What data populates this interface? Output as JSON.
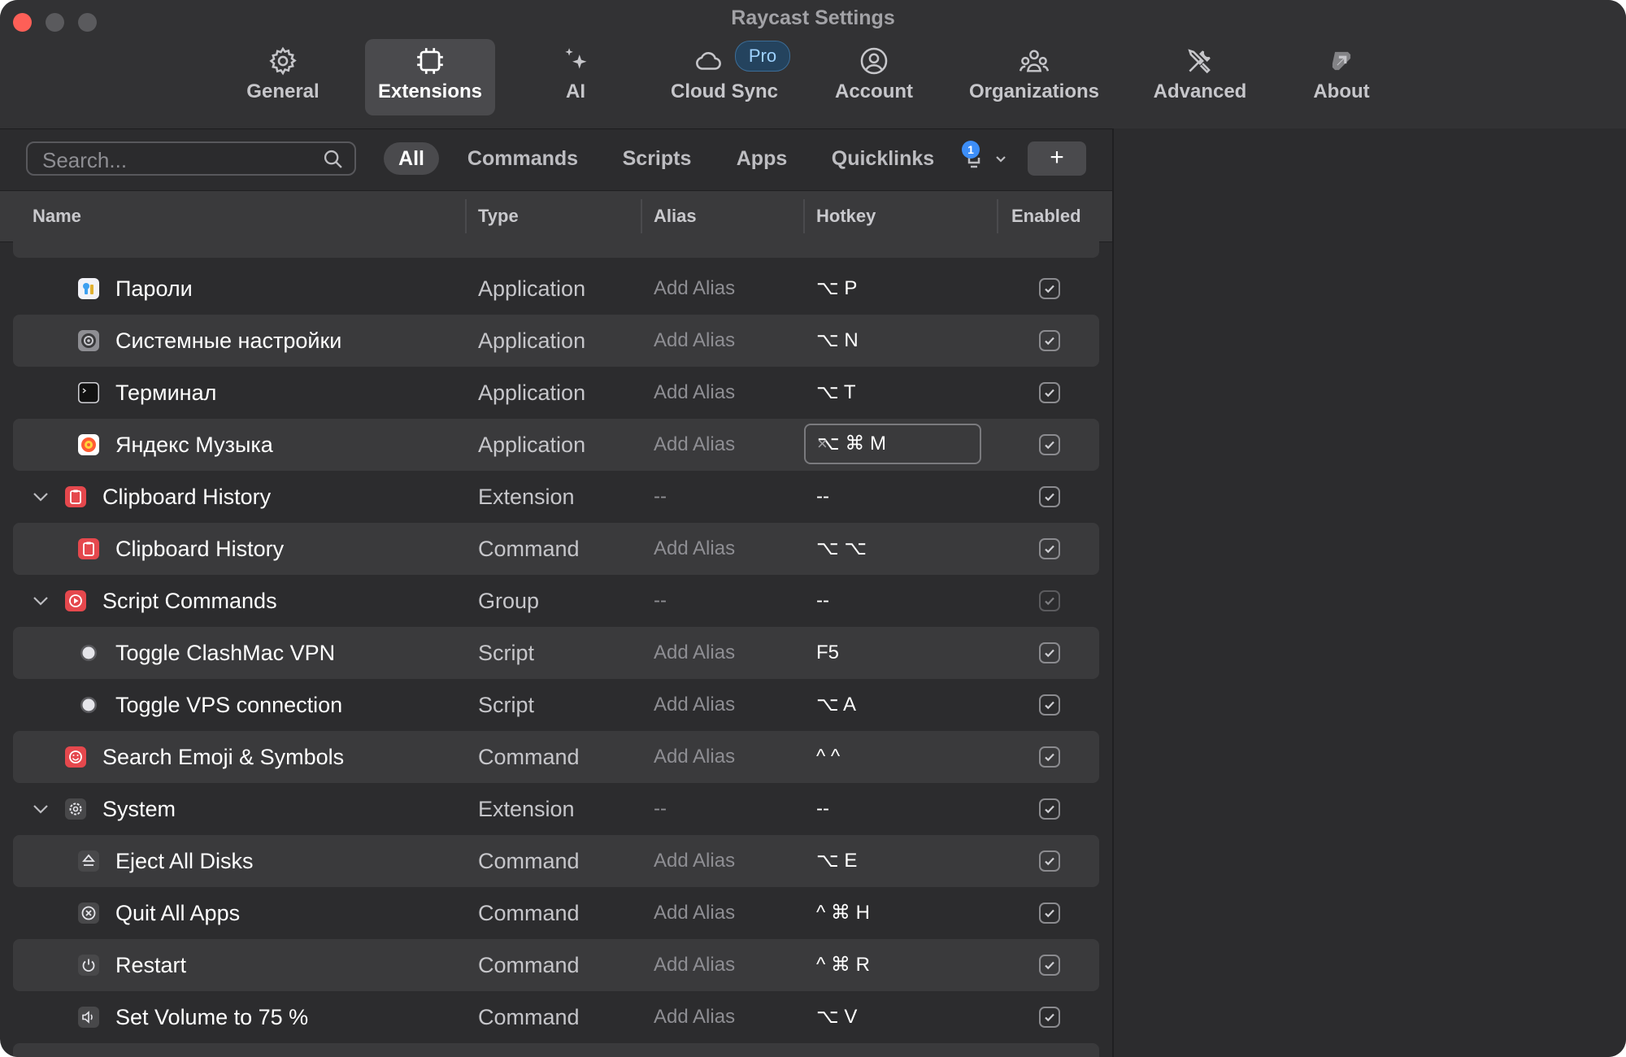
{
  "window": {
    "title": "Raycast Settings"
  },
  "tabs": [
    {
      "label": "General",
      "icon": "gear-icon"
    },
    {
      "label": "Extensions",
      "icon": "chip-icon"
    },
    {
      "label": "AI",
      "icon": "sparkles-icon"
    },
    {
      "label": "Cloud Sync",
      "icon": "cloud-icon",
      "badge": "Pro"
    },
    {
      "label": "Account",
      "icon": "person-circle-icon"
    },
    {
      "label": "Organizations",
      "icon": "people-icon"
    },
    {
      "label": "Advanced",
      "icon": "tools-icon"
    },
    {
      "label": "About",
      "icon": "raycast-logo-icon"
    }
  ],
  "active_tab": "Extensions",
  "search": {
    "placeholder": "Search...",
    "value": ""
  },
  "filters": [
    "All",
    "Commands",
    "Scripts",
    "Apps",
    "Quicklinks"
  ],
  "active_filter": "All",
  "notifications": {
    "count": "1"
  },
  "add_button": {
    "label": "+"
  },
  "columns": {
    "name": "Name",
    "type": "Type",
    "alias": "Alias",
    "hotkey": "Hotkey",
    "enabled": "Enabled"
  },
  "rows": [
    {
      "name": "Пароли",
      "type": "Application",
      "alias": "Add Alias",
      "hotkey": "⌥ P",
      "enabled": true,
      "icon": "passwords-app-icon"
    },
    {
      "name": "Системные настройки",
      "type": "Application",
      "alias": "Add Alias",
      "hotkey": "⌥ N",
      "enabled": true,
      "icon": "system-settings-app-icon"
    },
    {
      "name": "Терминал",
      "type": "Application",
      "alias": "Add Alias",
      "hotkey": "⌥ T",
      "enabled": true,
      "icon": "terminal-app-icon"
    },
    {
      "name": "Яндекс Музыка",
      "type": "Application",
      "alias": "Add Alias",
      "hotkey": "⌥ ⌘ M",
      "enabled": true,
      "icon": "yandex-music-app-icon",
      "editing_hotkey": true,
      "clear_label": "×"
    },
    {
      "name": "Clipboard History",
      "type": "Extension",
      "alias": "--",
      "hotkey": "--",
      "enabled": true,
      "icon": "clipboard-icon",
      "group": true
    },
    {
      "name": "Clipboard History",
      "type": "Command",
      "alias": "Add Alias",
      "hotkey": "⌥ ⌥",
      "enabled": true,
      "icon": "clipboard-icon"
    },
    {
      "name": "Script Commands",
      "type": "Group",
      "alias": "--",
      "hotkey": "--",
      "enabled": true,
      "icon": "script-commands-icon",
      "group": true,
      "dim": true
    },
    {
      "name": "Toggle ClashMac VPN",
      "type": "Script",
      "alias": "Add Alias",
      "hotkey": "F5",
      "enabled": true,
      "icon": "script-dot-icon"
    },
    {
      "name": "Toggle VPS connection",
      "type": "Script",
      "alias": "Add Alias",
      "hotkey": "⌥ A",
      "enabled": true,
      "icon": "script-dot-icon"
    },
    {
      "name": "Search Emoji & Symbols",
      "type": "Command",
      "alias": "Add Alias",
      "hotkey": "^ ^",
      "enabled": true,
      "icon": "emoji-icon",
      "top": true
    },
    {
      "name": "System",
      "type": "Extension",
      "alias": "--",
      "hotkey": "--",
      "enabled": true,
      "icon": "system-gear-icon",
      "group": true
    },
    {
      "name": "Eject All Disks",
      "type": "Command",
      "alias": "Add Alias",
      "hotkey": "⌥ E",
      "enabled": true,
      "icon": "eject-icon"
    },
    {
      "name": "Quit All Apps",
      "type": "Command",
      "alias": "Add Alias",
      "hotkey": "^ ⌘ H",
      "enabled": true,
      "icon": "quit-icon"
    },
    {
      "name": "Restart",
      "type": "Command",
      "alias": "Add Alias",
      "hotkey": "^ ⌘ R",
      "enabled": true,
      "icon": "power-icon"
    },
    {
      "name": "Set Volume to 75 %",
      "type": "Command",
      "alias": "Add Alias",
      "hotkey": "⌥ V",
      "enabled": true,
      "icon": "speaker-icon"
    }
  ]
}
